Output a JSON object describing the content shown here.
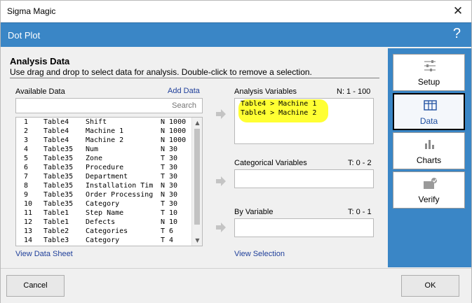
{
  "window": {
    "title": "Sigma Magic",
    "close_label": "✕"
  },
  "header": {
    "title": "Dot Plot",
    "help_label": "?"
  },
  "section": {
    "title": "Analysis Data",
    "subtitle": "Use drag and drop to select data for analysis. Double-click to remove a selection."
  },
  "available": {
    "label": "Available Data",
    "add_link": "Add Data",
    "search_placeholder": "Search",
    "view_link": "View Data Sheet",
    "rows": [
      [
        "1",
        "Table4",
        "Shift",
        "N 1000"
      ],
      [
        "2",
        "Table4",
        "Machine 1",
        "N 1000"
      ],
      [
        "3",
        "Table4",
        "Machine 2",
        "N 1000"
      ],
      [
        "4",
        "Table35",
        "Num",
        "N 30"
      ],
      [
        "5",
        "Table35",
        "Zone",
        "T 30"
      ],
      [
        "6",
        "Table35",
        "Procedure",
        "T 30"
      ],
      [
        "7",
        "Table35",
        "Department",
        "T 30"
      ],
      [
        "8",
        "Table35",
        "Installation Tim",
        "N 30"
      ],
      [
        "9",
        "Table35",
        "Order Processing",
        "N 30"
      ],
      [
        "10",
        "Table35",
        "Category",
        "T 30"
      ],
      [
        "11",
        "Table1",
        "Step Name",
        "T 10"
      ],
      [
        "12",
        "Table1",
        "Defects",
        "N 10"
      ],
      [
        "13",
        "Table2",
        "Categories",
        "T 6"
      ],
      [
        "14",
        "Table3",
        "Category",
        "T 4"
      ]
    ]
  },
  "analysis": {
    "label": "Analysis Variables",
    "range": "N: 1 - 100",
    "items": [
      "Table4 > Machine 1",
      "Table4 > Machine 2"
    ]
  },
  "categorical": {
    "label": "Categorical Variables",
    "range": "T: 0 - 2"
  },
  "byvar": {
    "label": "By Variable",
    "range": "T: 0 - 1",
    "view_link": "View Selection"
  },
  "sidebar": {
    "items": [
      {
        "label": "Setup",
        "icon": "sliders-icon"
      },
      {
        "label": "Data",
        "icon": "table-icon"
      },
      {
        "label": "Charts",
        "icon": "bar-chart-icon"
      },
      {
        "label": "Verify",
        "icon": "verify-icon"
      }
    ]
  },
  "footer": {
    "cancel_label": "Cancel",
    "ok_label": "OK"
  },
  "colors": {
    "accent": "#3a86c6",
    "highlight": "#ffff33",
    "link": "#1f3f9a"
  }
}
